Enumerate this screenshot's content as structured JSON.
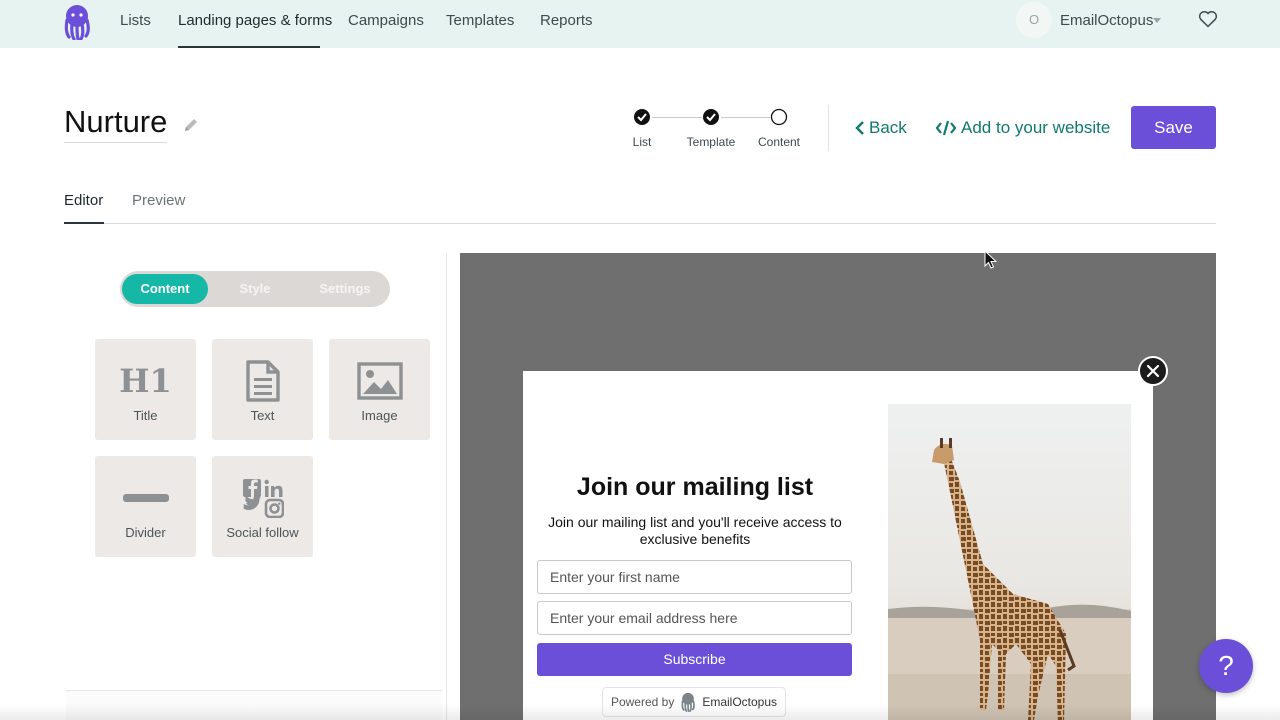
{
  "nav": {
    "items": [
      {
        "label": "Lists"
      },
      {
        "label": "Landing pages & forms",
        "active": true
      },
      {
        "label": "Campaigns"
      },
      {
        "label": "Templates"
      },
      {
        "label": "Reports"
      }
    ],
    "account_initial": "O",
    "account_name": "EmailOctopus",
    "favorites_icon": "heart-icon"
  },
  "header": {
    "title": "Nurture",
    "edit_icon": "pencil-icon",
    "steps": [
      {
        "label": "List",
        "status": "complete"
      },
      {
        "label": "Template",
        "status": "complete"
      },
      {
        "label": "Content",
        "status": "current"
      }
    ],
    "back_label": "Back",
    "add_label": "Add to your website",
    "save_label": "Save"
  },
  "tabs": [
    {
      "label": "Editor",
      "active": true
    },
    {
      "label": "Preview"
    }
  ],
  "panel": {
    "segments": [
      {
        "label": "Content",
        "active": true
      },
      {
        "label": "Style"
      },
      {
        "label": "Settings"
      }
    ],
    "blocks": [
      {
        "label": "Title",
        "icon": "h1-icon",
        "icon_text": "H1"
      },
      {
        "label": "Text",
        "icon": "document-icon"
      },
      {
        "label": "Image",
        "icon": "image-icon"
      },
      {
        "label": "Divider",
        "icon": "divider-icon"
      },
      {
        "label": "Social follow",
        "icon": "social-icons"
      }
    ]
  },
  "preview": {
    "form": {
      "title": "Join our mailing list",
      "description": "Join our mailing list and you'll receive access to exclusive benefits",
      "first_name_placeholder": "Enter your first name",
      "email_placeholder": "Enter your email address here",
      "subscribe_label": "Subscribe",
      "powered_prefix": "Powered by",
      "powered_brand": "EmailOctopus"
    },
    "image": "giraffe-photo"
  },
  "help": {
    "label": "?"
  },
  "colors": {
    "brand_purple": "#6b4fd8",
    "teal": "#15b8a6",
    "link_teal": "#0f7a6e",
    "nav_bg": "#e6f3f1",
    "preview_bg": "#6f6f6f"
  }
}
